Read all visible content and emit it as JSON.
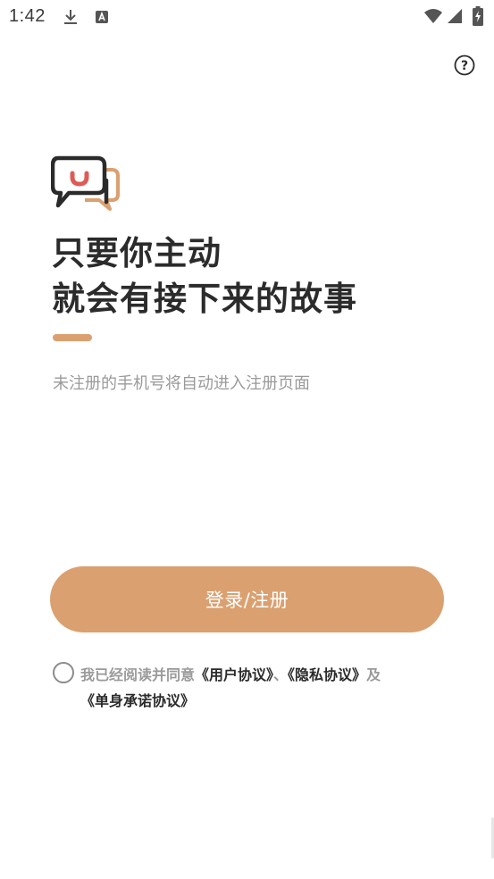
{
  "status_bar": {
    "time": "1:42",
    "icons": [
      "download-icon",
      "a-notification-icon",
      "wifi-icon",
      "signal-icon",
      "battery-charging-icon"
    ]
  },
  "help": {
    "icon": "help-circle-icon",
    "label": "?"
  },
  "logo": {
    "icon": "chat-bubbles-logo",
    "colors": {
      "outline": "#2b2b2b",
      "accent": "#dba070",
      "smile": "#e05a55"
    }
  },
  "headline": {
    "line1": "只要你主动",
    "line2": "就会有接下来的故事"
  },
  "subtitle": "未注册的手机号将自动进入注册页面",
  "login_button": {
    "label": "登录/注册",
    "color": "#dba070"
  },
  "agreement": {
    "prefix": "我已经阅读并同意",
    "user_agreement": "《用户协议》",
    "separator": "、",
    "privacy_agreement": "《隐私协议》",
    "and": "及",
    "single_agreement": "《单身承诺协议》"
  },
  "colors": {
    "accent": "#dba070",
    "text_dark": "#2b2b2b",
    "text_muted": "#9a9a9a"
  }
}
